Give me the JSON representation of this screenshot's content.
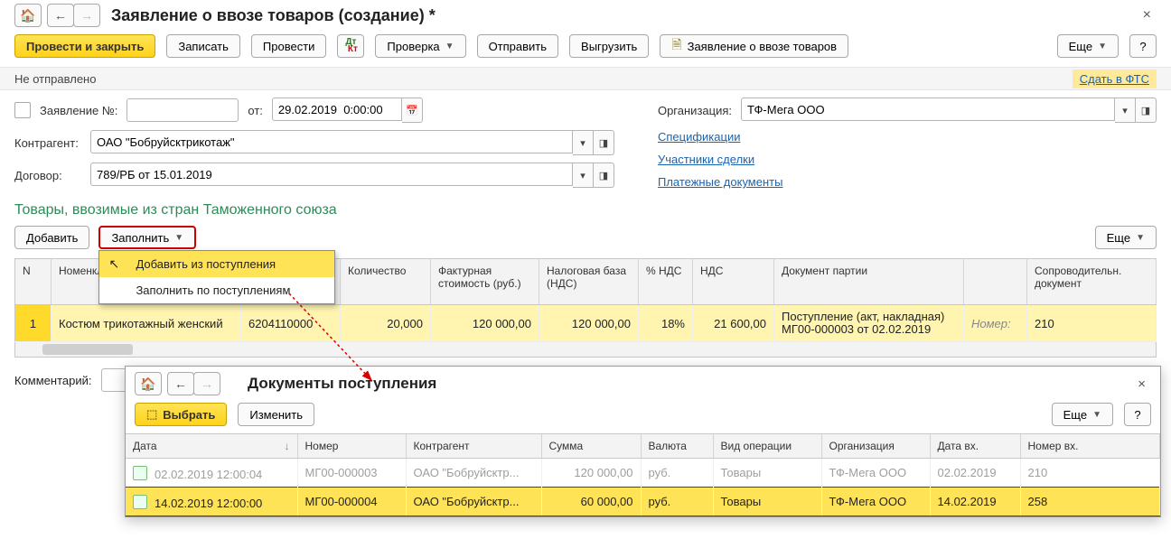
{
  "header": {
    "title": "Заявление о ввозе товаров (создание) *"
  },
  "toolbar": {
    "post_close": "Провести и закрыть",
    "write": "Записать",
    "post": "Провести",
    "check": "Проверка",
    "send": "Отправить",
    "export": "Выгрузить",
    "declaration": "Заявление о ввозе товаров",
    "more": "Еще"
  },
  "status": {
    "text": "Не отправлено",
    "fts_link": "Сдать в ФТС"
  },
  "form": {
    "decl_no_label": "Заявление №:",
    "decl_no": "",
    "from_label": "от:",
    "date": "29.02.2019  0:00:00",
    "org_label": "Организация:",
    "org": "ТФ-Мега ООО",
    "contr_label": "Контрагент:",
    "contr": "ОАО \"Бобруйсктрикотаж\"",
    "contract_label": "Договор:",
    "contract": "789/РБ от 15.01.2019",
    "links": {
      "spec": "Спецификации",
      "deal": "Участники сделки",
      "paydocs": "Платежные документы"
    }
  },
  "goods": {
    "section_title": "Товары, ввозимые из стран Таможенного союза",
    "add_btn": "Добавить",
    "fill_btn": "Заполнить",
    "more_btn": "Еще",
    "fill_menu": {
      "from_receipt": "Добавить из поступления",
      "by_receipts": "Заполнить по поступлениям"
    },
    "columns": {
      "n": "N",
      "item": "Номенкл",
      "tnved": "",
      "qty": "Количество",
      "cost": "Фактурная стоимость (руб.)",
      "taxbase": "Налоговая база (НДС)",
      "vat_rate": "% НДС",
      "vat": "НДС",
      "batch": "Документ партии",
      "acc_label": "Номер:",
      "accdoc": "Сопроводительн. документ"
    },
    "row": {
      "n": "1",
      "item": "Костюм трикотажный женский",
      "tnved": "6204110000",
      "qty": "20,000",
      "cost": "120 000,00",
      "taxbase": "120 000,00",
      "vat_rate": "18%",
      "vat": "21 600,00",
      "batch": "Поступление (акт, накладная) МГ00-000003 от 02.02.2019",
      "accdoc": "210"
    }
  },
  "comment": {
    "label": "Комментарий:",
    "value": ""
  },
  "modal": {
    "title": "Документы поступления",
    "select": "Выбрать",
    "edit": "Изменить",
    "more": "Еще",
    "columns": {
      "date": "Дата",
      "number": "Номер",
      "contr": "Контрагент",
      "sum": "Сумма",
      "curr": "Валюта",
      "op": "Вид операции",
      "org": "Организация",
      "in_date": "Дата вх.",
      "in_no": "Номер вх."
    },
    "rows": [
      {
        "date": "02.02.2019 12:00:04",
        "number": "МГ00-000003",
        "contr": "ОАО \"Бобруйсктр...",
        "sum": "120 000,00",
        "curr": "руб.",
        "op": "Товары",
        "org": "ТФ-Мега ООО",
        "in_date": "02.02.2019",
        "in_no": "210"
      },
      {
        "date": "14.02.2019 12:00:00",
        "number": "МГ00-000004",
        "contr": "ОАО \"Бобруйсктр...",
        "sum": "60 000,00",
        "curr": "руб.",
        "op": "Товары",
        "org": "ТФ-Мега ООО",
        "in_date": "14.02.2019",
        "in_no": "258"
      }
    ]
  }
}
